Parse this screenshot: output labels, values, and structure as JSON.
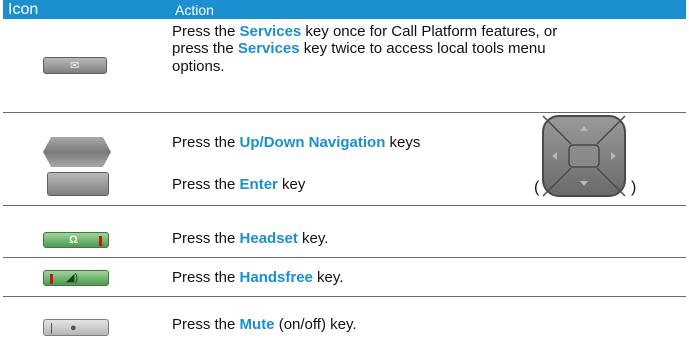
{
  "header": {
    "icon_col": "Icon",
    "action_col": "Action"
  },
  "rows": {
    "services": {
      "line1_pre": "Press the ",
      "line1_kw": "Services",
      "line1_post": " key once for Call Platform features, or",
      "line2_pre": "press the ",
      "line2_kw": "Services",
      "line2_post": " key twice to access local tools menu",
      "line3": "options."
    },
    "navigation": {
      "line1_pre": "Press the ",
      "line1_kw": "Up/Down Navigation",
      "line1_post": " keys",
      "line2_pre": "Press the ",
      "line2_kw": "Enter",
      "line2_post": " key",
      "paren_open": "(",
      "paren_close": ")"
    },
    "headset": {
      "pre": "Press the ",
      "kw": "Headset",
      "post": " key."
    },
    "handsfree": {
      "pre": "Press the ",
      "kw": "Handsfree",
      "post": " key."
    },
    "mute": {
      "pre": "Press the ",
      "kw": "Mute",
      "post": " (on/off) key."
    }
  },
  "icons": {
    "services": "services-key-icon",
    "up_down": "up-down-navigation-keys-icon",
    "enter": "enter-key-icon",
    "headset": "headset-key-icon",
    "handsfree": "handsfree-key-icon",
    "mute": "mute-key-icon",
    "navpad": "navigation-pad-icon"
  },
  "colors": {
    "header_bg": "#1b8fd0",
    "keyword": "#1b8fd0",
    "rule": "#6a6a6a",
    "key_green": "#5fae5c",
    "indicator_red": "#c21a12"
  }
}
